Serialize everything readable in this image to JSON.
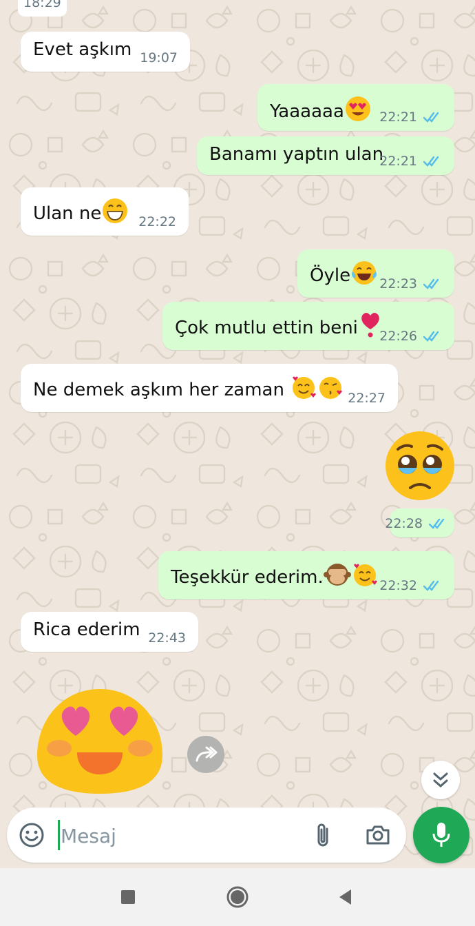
{
  "colors": {
    "incoming_bubble": "#ffffff",
    "outgoing_bubble": "#d9fdd3",
    "tick_blue": "#53bdeb",
    "accent_green": "#1fa855",
    "wallpaper": "#efe7dd"
  },
  "chat": {
    "top_partial_time": "18:29",
    "messages": [
      {
        "direction": "in",
        "text": "Evet aşkım",
        "emoji": "",
        "time": "19:07"
      },
      {
        "direction": "out",
        "text": "Yaaaaaa",
        "emoji": "smiling-face-with-heart-eyes",
        "time": "22:21",
        "read": true
      },
      {
        "direction": "out",
        "text": "Banamı yaptın ulan",
        "emoji": "",
        "time": "22:21",
        "read": true
      },
      {
        "direction": "in",
        "text": "Ulan ne",
        "emoji": "grinning-face",
        "time": "22:22"
      },
      {
        "direction": "out",
        "text": "Öyle",
        "emoji": "face-with-tears-of-joy",
        "time": "22:23",
        "read": true
      },
      {
        "direction": "out",
        "text": "Çok mutlu ettin beni",
        "emoji": "red-heart-exclamation",
        "time": "22:26",
        "read": true
      },
      {
        "direction": "in",
        "text": "Ne demek aşkım her zaman",
        "emoji": "smiling-face-with-hearts, face-blowing-kiss",
        "time": "22:27"
      },
      {
        "direction": "out",
        "text": "",
        "emoji": "pleading-face",
        "time": "22:28",
        "read": true
      },
      {
        "direction": "out",
        "text": "Teşekkür ederim.",
        "emoji": "see-no-evil-monkey, smiling-face-with-hearts",
        "time": "22:32",
        "read": true
      },
      {
        "direction": "in",
        "text": "Rica ederim",
        "emoji": "",
        "time": "22:43"
      }
    ],
    "last_sticker": "heart-eyes-sticker"
  },
  "composer": {
    "placeholder": "Mesaj",
    "value": ""
  },
  "icons": {
    "emoji_button": "smiley-icon",
    "attach": "paperclip-icon",
    "camera": "camera-icon",
    "mic": "microphone-icon",
    "forward": "forward-icon",
    "scroll_down": "double-chevron-down-icon"
  },
  "navbar": {
    "buttons": [
      "recents-square-icon",
      "home-circle-icon",
      "back-triangle-icon"
    ]
  }
}
